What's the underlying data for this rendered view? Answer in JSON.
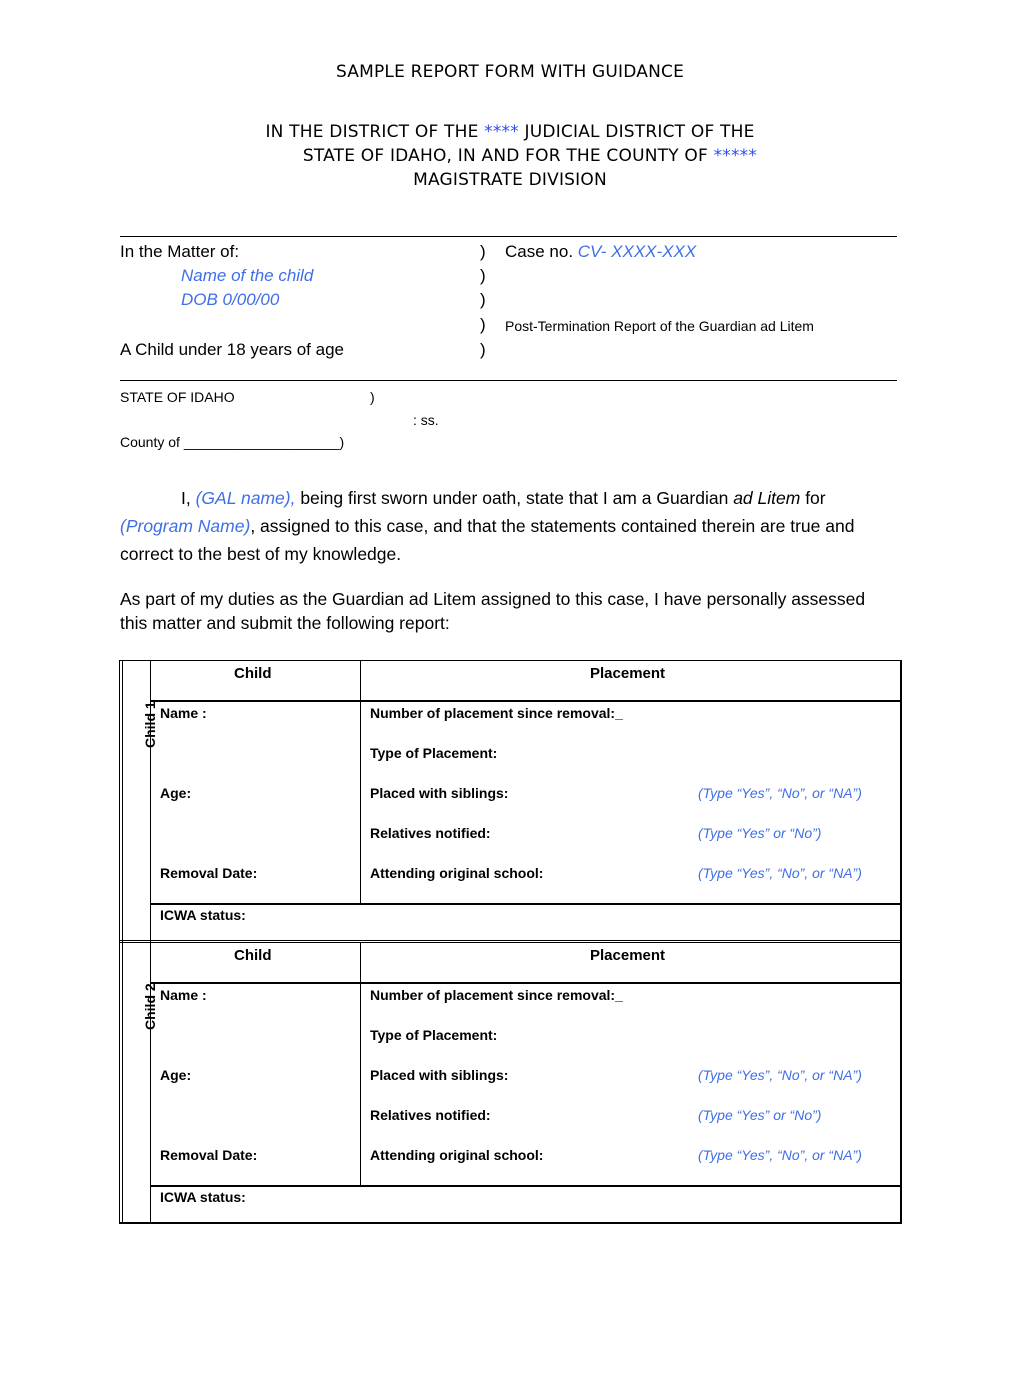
{
  "header": {
    "title": "SAMPLE REPORT FORM WITH GUIDANCE",
    "court_line1_a": "IN THE DISTRICT OF THE ",
    "court_line1_stars": "****",
    "court_line1_b": " JUDICIAL DISTRICT OF THE",
    "court_line2_a": "STATE OF IDAHO, IN AND FOR THE COUNTY OF ",
    "court_line2_stars": "*****",
    "court_line3": "MAGISTRATE DIVISION"
  },
  "caption": {
    "matter_label": "In the Matter of:",
    "child_name_placeholder": "Name of the child",
    "dob_placeholder": "DOB 0/00/00",
    "child_age_label": "A Child under 18 years of age",
    "paren": ")",
    "case_label": "Case no. ",
    "case_number_placeholder": "CV- XXXX-XXX",
    "report_title": "Post-Termination Report of the Guardian ad Litem"
  },
  "venue": {
    "state": "STATE OF IDAHO",
    "paren": ")",
    "ss": ": ss.",
    "county_label": "County of ____________________)"
  },
  "oath": {
    "prefix": "I, ",
    "gal_placeholder": "(GAL name),",
    "text1": " being first sworn under oath, state that I am a Guardian ",
    "ad_litem": "ad Litem",
    "text2": " for",
    "program_placeholder": "(Program Name)",
    "text3": ", assigned to this case, and that the statements contained therein are true and",
    "text4": "correct to the best of my knowledge."
  },
  "duties": {
    "line1": "As part of my duties as the Guardian ad Litem assigned to this case, I have personally assessed",
    "line2": "this matter and submit the following report:"
  },
  "table": {
    "col_child": "Child",
    "col_placement": "Placement",
    "children": [
      {
        "label": "Child 1",
        "name_label": "Name :",
        "age_label": "Age:",
        "removal_label": "Removal Date:",
        "num_placements_label": "Number of placement since removal:_",
        "type_label": "Type of Placement:",
        "siblings_label": "Placed with siblings:",
        "siblings_hint": "(Type “Yes”, “No”, or “NA”)",
        "relatives_label": "Relatives notified:",
        "relatives_hint": "(Type “Yes” or “No”)",
        "school_label": "Attending original school:",
        "school_hint": "(Type “Yes”, “No”, or “NA”)",
        "icwa_label": "ICWA status:"
      },
      {
        "label": "Child 2",
        "name_label": "Name :",
        "age_label": "Age:",
        "removal_label": "Removal Date:",
        "num_placements_label": "Number of placement since removal:_",
        "type_label": "Type of Placement:",
        "siblings_label": "Placed with siblings:",
        "siblings_hint": "(Type “Yes”, “No”, or “NA”)",
        "relatives_label": "Relatives notified:",
        "relatives_hint": "(Type “Yes” or “No”)",
        "school_label": "Attending original school:",
        "school_hint": "(Type “Yes”, “No”, or “NA”)",
        "icwa_label": "ICWA status:"
      }
    ]
  },
  "colors": {
    "placeholder_blue": "#3f6fe6",
    "star_blue": "#2d4cf5"
  }
}
